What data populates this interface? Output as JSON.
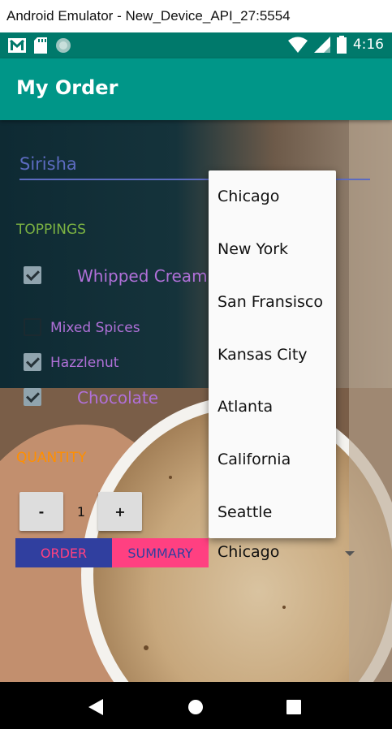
{
  "window": {
    "title": "Android Emulator - New_Device_API_27:5554"
  },
  "status_bar": {
    "time": "4:16",
    "icons_left": [
      "gmail-icon",
      "sd-card-icon",
      "circle-notification-icon"
    ],
    "icons_right": [
      "wifi-icon",
      "signal-icon",
      "battery-icon"
    ]
  },
  "app_bar": {
    "title": "My Order",
    "color": "#009688"
  },
  "form": {
    "name_value": "Sirisha",
    "toppings_label": "TOPPINGS",
    "toppings": [
      {
        "label": "Whipped Cream",
        "checked": true
      },
      {
        "label": "Mixed Spices",
        "checked": false
      },
      {
        "label": "Hazzlenut",
        "checked": true
      },
      {
        "label": "Chocolate",
        "checked": true
      }
    ],
    "quantity_label": "QUANTITY",
    "decrement_label": "-",
    "increment_label": "+",
    "quantity": "1",
    "order_label": "ORDER",
    "summary_label": "SUMMARY",
    "city_selected": "Chicago"
  },
  "dropdown": {
    "options": [
      "Chicago",
      "New York",
      "San Fransisco",
      "Kansas City",
      "Atlanta",
      "California",
      "Seattle"
    ]
  },
  "colors": {
    "accent_pink": "#ff4081",
    "primary_indigo": "#303f9f",
    "toppings_green": "#7cb342",
    "quantity_orange": "#ff8f00",
    "checkbox_label_purple": "#b070d8"
  },
  "nav_bar": {
    "icons": [
      "back-icon",
      "home-icon",
      "recents-icon"
    ]
  }
}
